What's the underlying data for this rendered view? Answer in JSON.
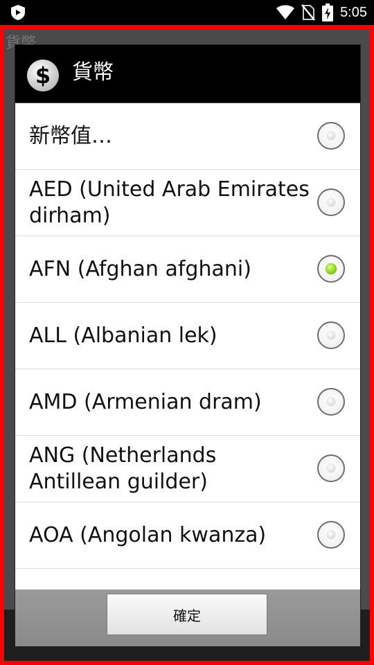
{
  "status_bar": {
    "time": "5:05",
    "icons": [
      "app-shield-icon",
      "wifi-icon",
      "no-sim-icon",
      "battery-charging-icon"
    ]
  },
  "background": {
    "app_title": "貨幣"
  },
  "dialog": {
    "title": "貨幣",
    "header_icon": "dollar-icon",
    "items": [
      {
        "label": "新幣值…",
        "checked": false
      },
      {
        "label": "AED (United Arab Emirates dirham)",
        "checked": false
      },
      {
        "label": "AFN (Afghan afghani)",
        "checked": true
      },
      {
        "label": "ALL (Albanian lek)",
        "checked": false
      },
      {
        "label": "AMD (Armenian dram)",
        "checked": false
      },
      {
        "label": "ANG (Netherlands Antillean guilder)",
        "checked": false
      },
      {
        "label": "AOA (Angolan kwanza)",
        "checked": false
      },
      {
        "label": "",
        "checked": false
      }
    ],
    "ok_label": "確定"
  },
  "colors": {
    "frame": "#ff0000",
    "radio_checked": "#8fd41a",
    "header_bg": "#000000"
  }
}
